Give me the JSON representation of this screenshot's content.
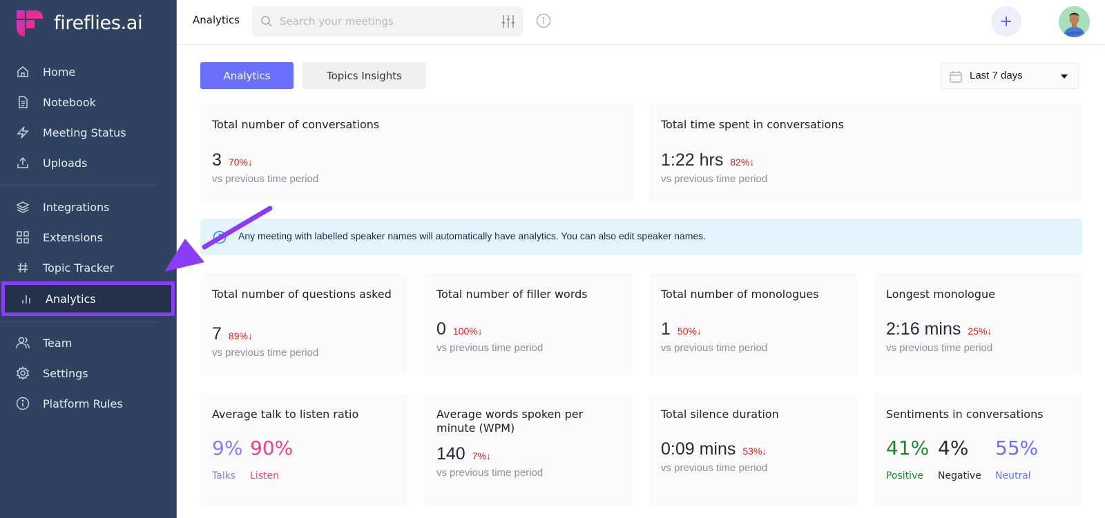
{
  "app": {
    "brand": "fireflies.ai"
  },
  "sidebar": {
    "items": [
      {
        "label": "Home",
        "icon": "home-icon"
      },
      {
        "label": "Notebook",
        "icon": "document-icon"
      },
      {
        "label": "Meeting Status",
        "icon": "lightning-icon"
      },
      {
        "label": "Uploads",
        "icon": "upload-icon"
      },
      {
        "label": "Integrations",
        "icon": "layers-icon"
      },
      {
        "label": "Extensions",
        "icon": "grid-icon"
      },
      {
        "label": "Topic Tracker",
        "icon": "hashtag-icon"
      },
      {
        "label": "Analytics",
        "icon": "bar-chart-icon",
        "active": true
      },
      {
        "label": "Team",
        "icon": "users-icon"
      },
      {
        "label": "Settings",
        "icon": "gear-icon"
      },
      {
        "label": "Platform Rules",
        "icon": "info-icon"
      }
    ]
  },
  "header": {
    "title": "Analytics",
    "search_placeholder": "Search your meetings"
  },
  "tabs": [
    {
      "label": "Analytics",
      "active": true
    },
    {
      "label": "Topics Insights",
      "active": false
    }
  ],
  "date_range": {
    "selected": "Last 7 days"
  },
  "banner": {
    "text": "Any meeting with labelled speaker names will automatically have analytics. You can also edit speaker names."
  },
  "comparison_label": "vs previous time period",
  "cards": {
    "conversations": {
      "title": "Total number of conversations",
      "value": "3",
      "delta": "70%↓"
    },
    "time_spent": {
      "title": "Total time spent in conversations",
      "value": "1:22 hrs",
      "delta": "82%↓"
    },
    "questions": {
      "title": "Total number of questions asked",
      "value": "7",
      "delta": "89%↓"
    },
    "filler_words": {
      "title": "Total number of filler words",
      "value": "0",
      "delta": "100%↓"
    },
    "monologues": {
      "title": "Total number of monologues",
      "value": "1",
      "delta": "50%↓"
    },
    "longest_monologue": {
      "title": "Longest monologue",
      "value": "2:16 mins",
      "delta": "25%↓"
    },
    "talk_listen": {
      "title": "Average talk to listen ratio",
      "talk_value": "9%",
      "talk_label": "Talks",
      "listen_value": "90%",
      "listen_label": "Listen"
    },
    "wpm": {
      "title": "Average words spoken per minute (WPM)",
      "value": "140",
      "delta": "7%↓"
    },
    "silence": {
      "title": "Total silence duration",
      "value": "0:09 mins",
      "delta": "53%↓"
    },
    "sentiments": {
      "title": "Sentiments in conversations",
      "positive_value": "41%",
      "positive_label": "Positive",
      "negative_value": "4%",
      "negative_label": "Negative",
      "neutral_value": "55%",
      "neutral_label": "Neutral"
    }
  },
  "colors": {
    "sidebar_bg": "#2f4360",
    "accent": "#6a70fb",
    "highlight": "#8b3cf7",
    "delta_down": "#e01a1a",
    "talk": "#7b7ffb",
    "listen": "#f0427a",
    "positive": "#1a8a2a",
    "negative": "#222b36",
    "neutral": "#6a70fb",
    "banner_bg": "#e2f3fc"
  }
}
